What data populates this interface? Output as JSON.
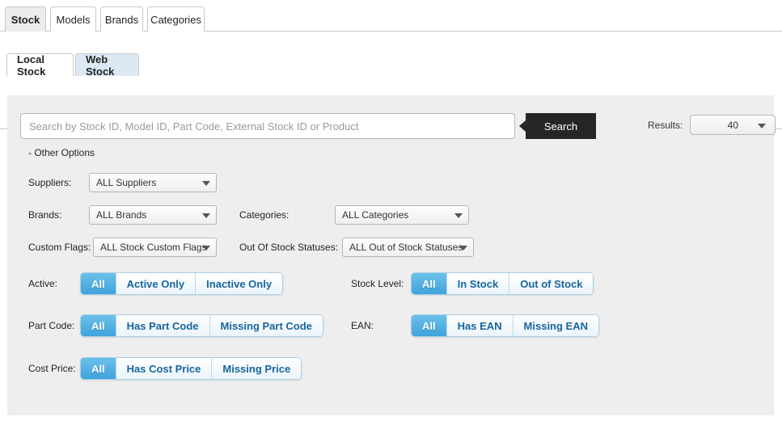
{
  "tabs": [
    {
      "label": "Stock",
      "active": true
    },
    {
      "label": "Models",
      "active": false
    },
    {
      "label": "Brands",
      "active": false
    },
    {
      "label": "Categories",
      "active": false
    }
  ],
  "subtabs": [
    {
      "label": "Local Stock",
      "selected": false
    },
    {
      "label": "Web Stock",
      "selected": true
    }
  ],
  "search": {
    "placeholder": "Search by Stock ID, Model ID, Part Code, External Stock ID or Product",
    "value": "",
    "button_label": "Search"
  },
  "results": {
    "label": "Results:",
    "value": "40"
  },
  "other_options_label": "- Other Options",
  "dropdowns": [
    {
      "label": "Suppliers:",
      "value": "ALL Suppliers"
    },
    {
      "label": "Brands:",
      "value": "ALL Brands"
    },
    {
      "label": "Categories:",
      "value": "ALL Categories"
    },
    {
      "label": "Custom Flags:",
      "value": "ALL Stock Custom Flags"
    },
    {
      "label": "Out Of Stock Statuses:",
      "value": "ALL Out of Stock Statuses"
    }
  ],
  "toggles": [
    {
      "label": "Active:",
      "options": [
        {
          "label": "All",
          "selected": true
        },
        {
          "label": "Active Only",
          "selected": false
        },
        {
          "label": "Inactive Only",
          "selected": false
        }
      ]
    },
    {
      "label": "Stock Level:",
      "options": [
        {
          "label": "All",
          "selected": true
        },
        {
          "label": "In Stock",
          "selected": false
        },
        {
          "label": "Out of Stock",
          "selected": false
        }
      ]
    },
    {
      "label": "Part Code:",
      "options": [
        {
          "label": "All",
          "selected": true
        },
        {
          "label": "Has Part Code",
          "selected": false
        },
        {
          "label": "Missing Part Code",
          "selected": false
        }
      ]
    },
    {
      "label": "EAN:",
      "options": [
        {
          "label": "All",
          "selected": true
        },
        {
          "label": "Has EAN",
          "selected": false
        },
        {
          "label": "Missing EAN",
          "selected": false
        }
      ]
    },
    {
      "label": "Cost Price:",
      "options": [
        {
          "label": "All",
          "selected": true
        },
        {
          "label": "Has Cost Price",
          "selected": false
        },
        {
          "label": "Missing Price",
          "selected": false
        }
      ]
    }
  ],
  "colors": {
    "panel_bg": "#eeeeee",
    "accent_blue": "#3fa3db",
    "toggle_text": "#17659e",
    "search_button_bg": "#262626",
    "subtab_selected_bg": "#dce9f5",
    "tab_active_bg": "#ececec"
  }
}
